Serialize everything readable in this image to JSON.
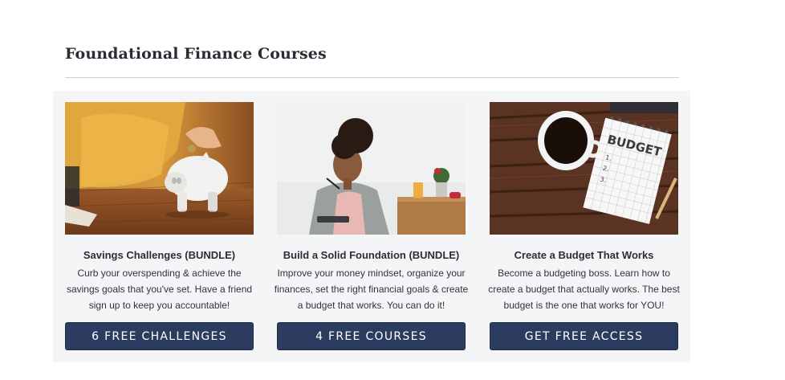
{
  "section": {
    "title": "Foundational Finance Courses"
  },
  "courses": [
    {
      "title": "Savings Challenges (BUNDLE)",
      "description": "Curb your overspending & achieve the savings goals that you've set. Have a friend sign up to keep you accountable!",
      "button_label": "6 FREE CHALLENGES",
      "image_icon": "piggy-bank-photo"
    },
    {
      "title": "Build a Solid Foundation (BUNDLE)",
      "description": "Improve your money mindset, organize your finances, set the right financial goals & create a budget that works. You can do it!",
      "button_label": "4 FREE COURSES",
      "image_icon": "woman-planning-photo"
    },
    {
      "title": "Create a Budget That Works",
      "description": "Become a budgeting boss. Learn how to create a budget that actually works. The best budget is the one that works for YOU!",
      "button_label": "GET FREE ACCESS",
      "image_icon": "budget-notepad-photo",
      "image_text": "BUDGET"
    }
  ],
  "colors": {
    "button_bg": "#2c3b60",
    "panel_bg": "#f4f5f7"
  }
}
